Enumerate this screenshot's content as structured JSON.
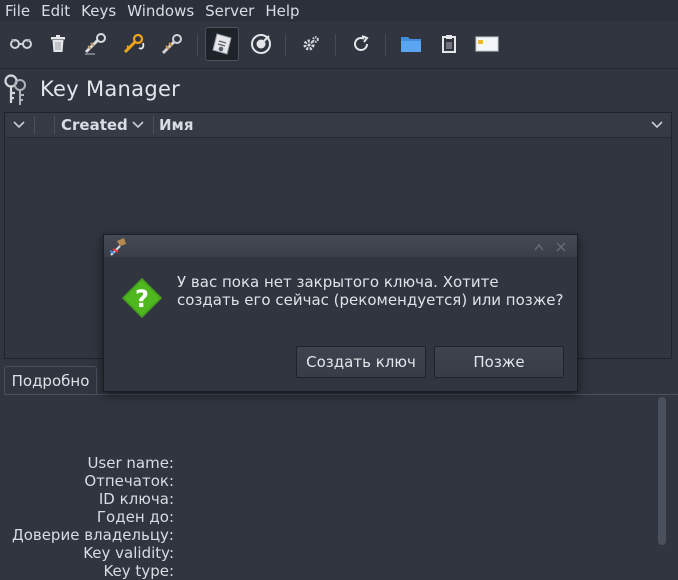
{
  "menubar": {
    "items": [
      "File",
      "Edit",
      "Keys",
      "Windows",
      "Server",
      "Help"
    ]
  },
  "toolbar": {
    "buttons": [
      "key-pair-icon",
      "delete-icon",
      "sign-key-icon",
      "export-key-icon",
      "import-key-icon",
      "certificate-icon",
      "keyserver-icon",
      "settings-icon",
      "refresh-icon",
      "folder-icon",
      "clipboard-icon",
      "card-icon"
    ]
  },
  "page": {
    "title": "Key Manager"
  },
  "keylist": {
    "columns": {
      "created": "Created",
      "name": "Имя"
    }
  },
  "details": {
    "tab_label": "Подробно",
    "labels": [
      "User name:",
      "Отпечаток:",
      "ID ключа:",
      "Годен до:",
      "Доверие владельцу:",
      "Key validity:",
      "Key type:"
    ]
  },
  "dialog": {
    "message_line1": "У вас пока нет закрытого ключа. Хотите",
    "message_line2": "создать его сейчас (рекомендуется) или позже?",
    "create_label": "Создать ключ",
    "later_label": "Позже"
  },
  "colors": {
    "background": "#30353f",
    "question_green": "#4fb81e"
  }
}
